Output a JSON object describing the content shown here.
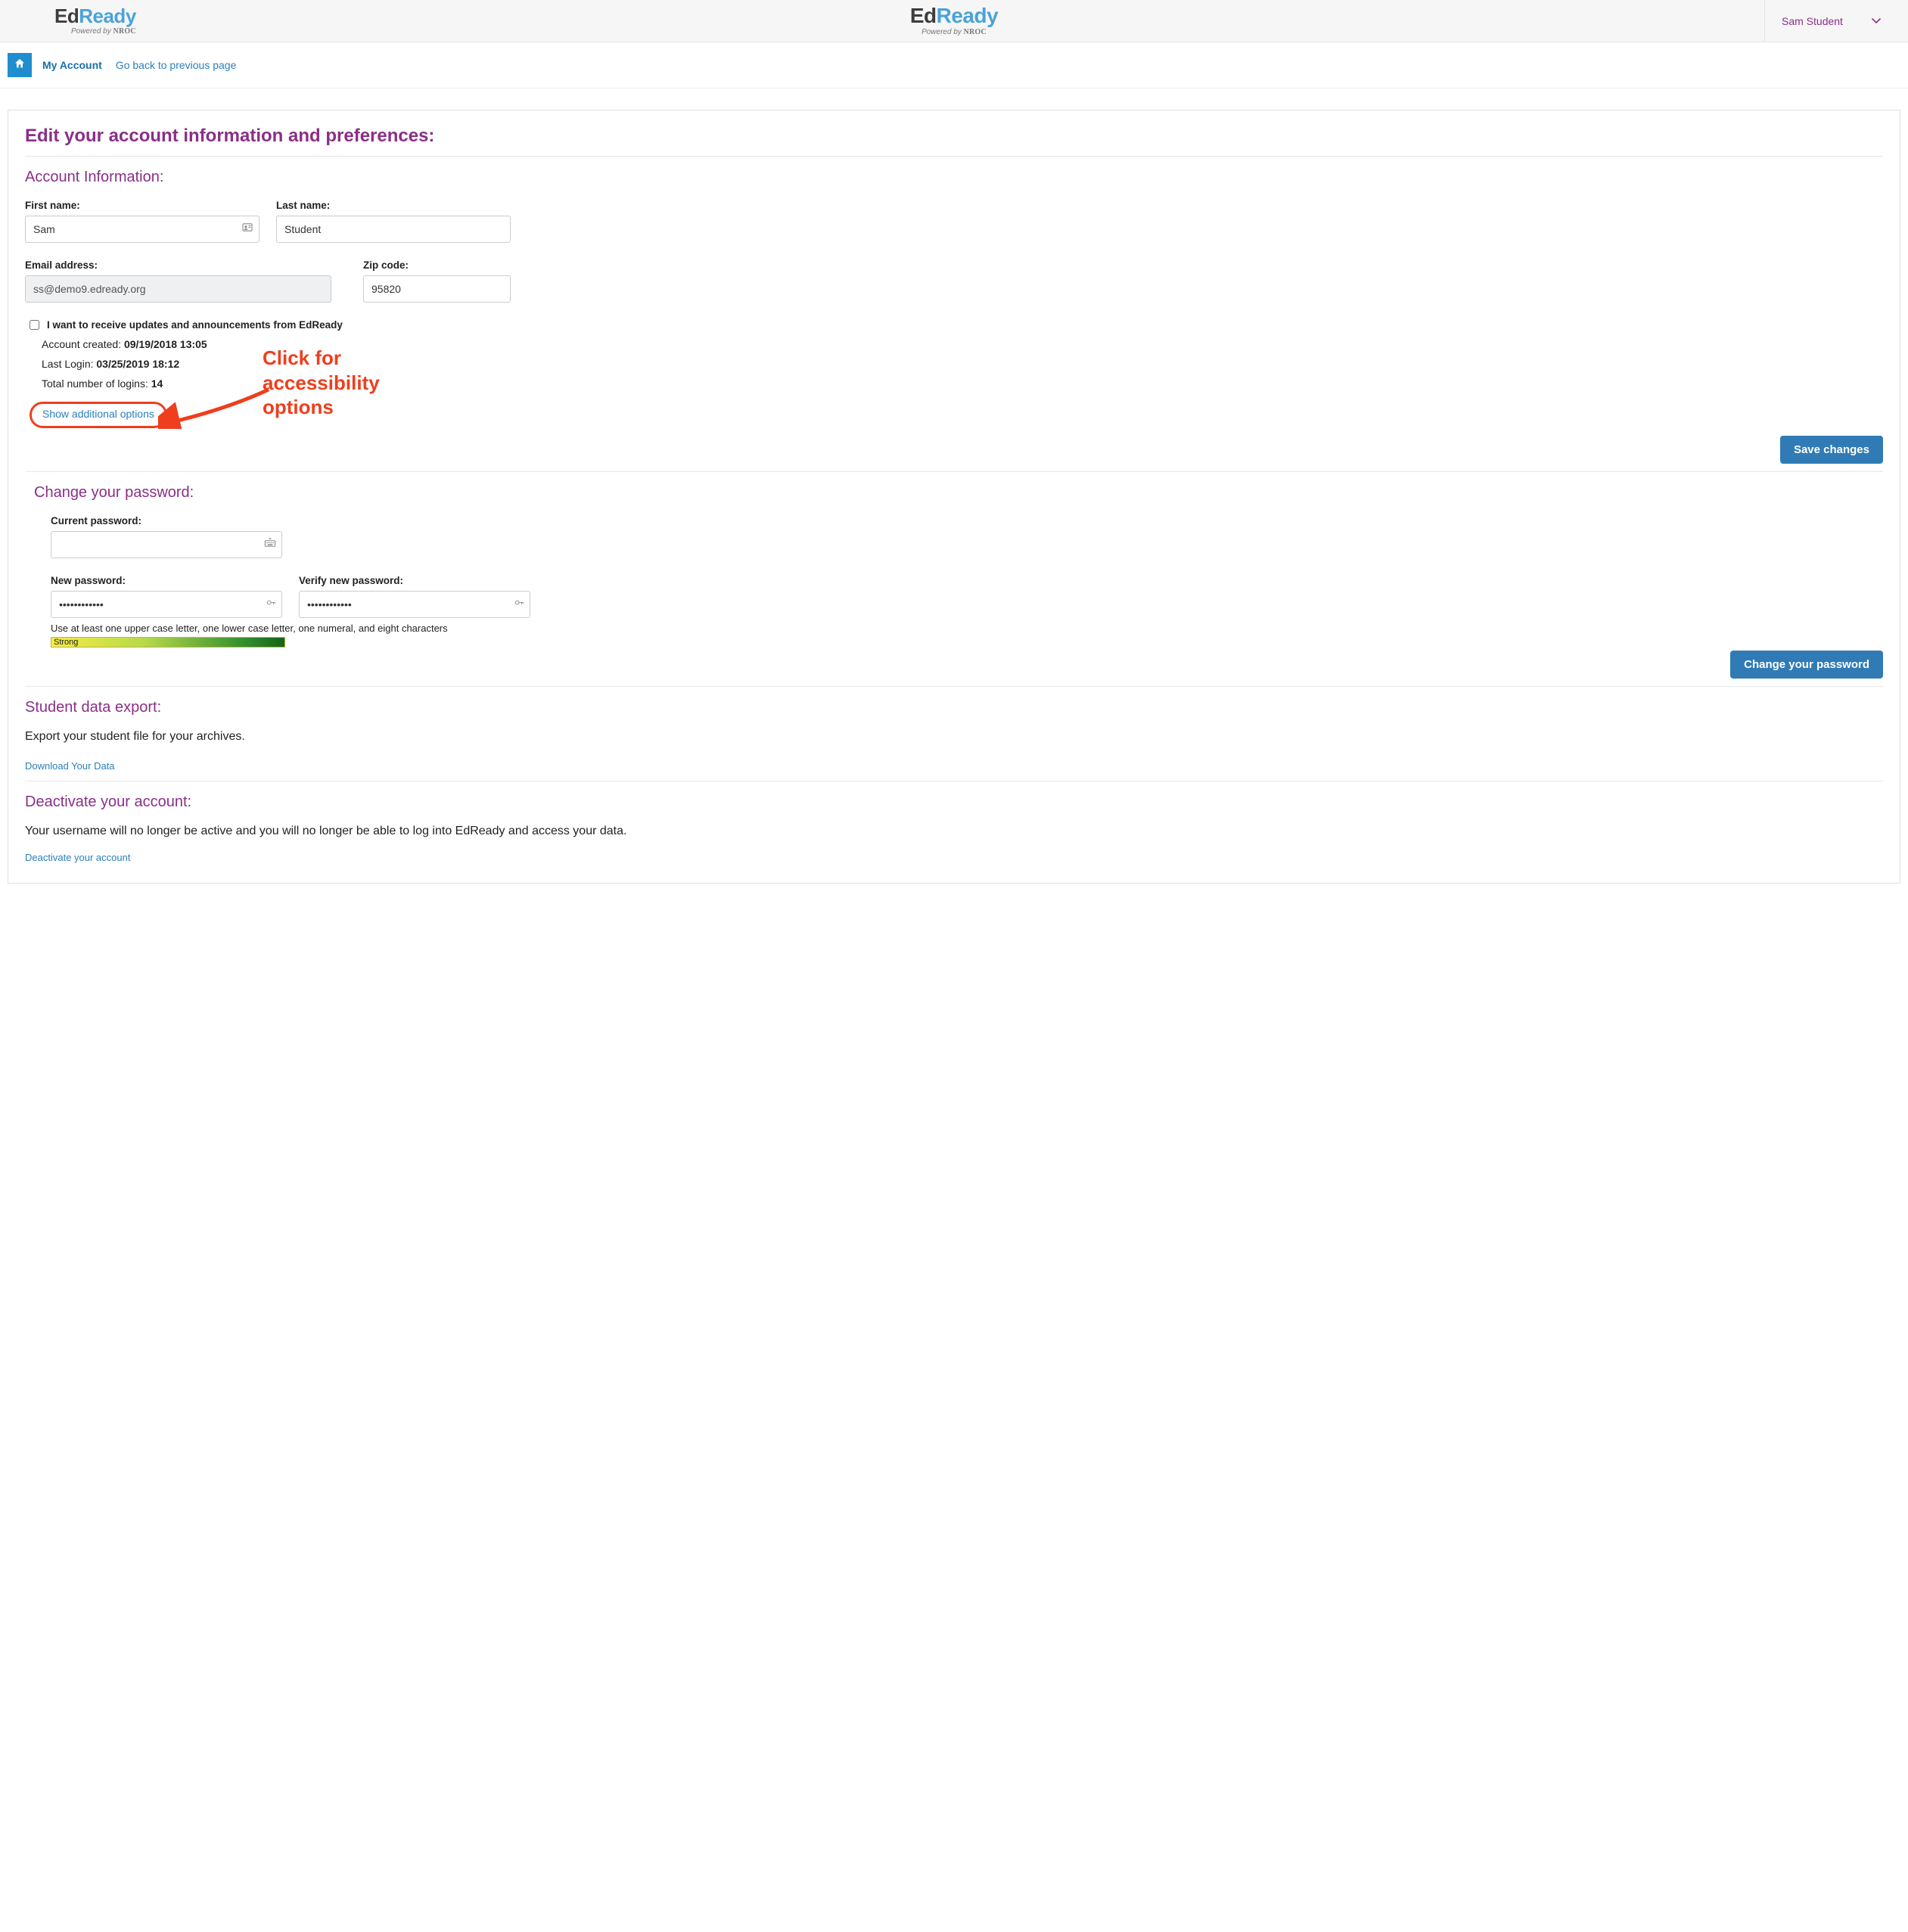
{
  "header": {
    "brand_ed": "Ed",
    "brand_ready": "Ready",
    "brand_tag_prefix": "Powered by ",
    "brand_tag_bold": "NROC",
    "user_name": "Sam Student"
  },
  "crumbs": {
    "current": "My Account",
    "back_link": "Go back to previous page"
  },
  "page": {
    "title": "Edit your account information and preferences:"
  },
  "account": {
    "section_title": "Account Information:",
    "first_name_label": "First name:",
    "first_name_value": "Sam",
    "last_name_label": "Last name:",
    "last_name_value": "Student",
    "email_label": "Email address:",
    "email_value": "ss@demo9.edready.org",
    "zip_label": "Zip code:",
    "zip_value": "95820",
    "updates_checkbox_label": "I want to receive updates and announcements from EdReady",
    "created_label": "Account created: ",
    "created_value": "09/19/2018 13:05",
    "lastlogin_label": "Last Login: ",
    "lastlogin_value": "03/25/2019 18:12",
    "logins_label": "Total number of logins: ",
    "logins_value": "14",
    "show_more_link": "Show additional options",
    "save_button": "Save changes"
  },
  "annotation": {
    "line1": "Click for",
    "line2": "accessibility",
    "line3": "options"
  },
  "password": {
    "section_title": "Change your password:",
    "current_label": "Current password:",
    "new_label": "New password:",
    "new_value": "••••••••••••",
    "verify_label": "Verify new password:",
    "verify_value": "••••••••••••",
    "hint": "Use at least one upper case letter, one lower case letter, one numeral, and eight characters",
    "strength_label": "Strong",
    "button": "Change your password"
  },
  "export": {
    "section_title": "Student data export:",
    "body": "Export your student file for your archives.",
    "link": "Download Your Data"
  },
  "deactivate": {
    "section_title": "Deactivate your account:",
    "body": "Your username will no longer be active and you will no longer be able to log into EdReady and access your data.",
    "link": "Deactivate your account"
  }
}
